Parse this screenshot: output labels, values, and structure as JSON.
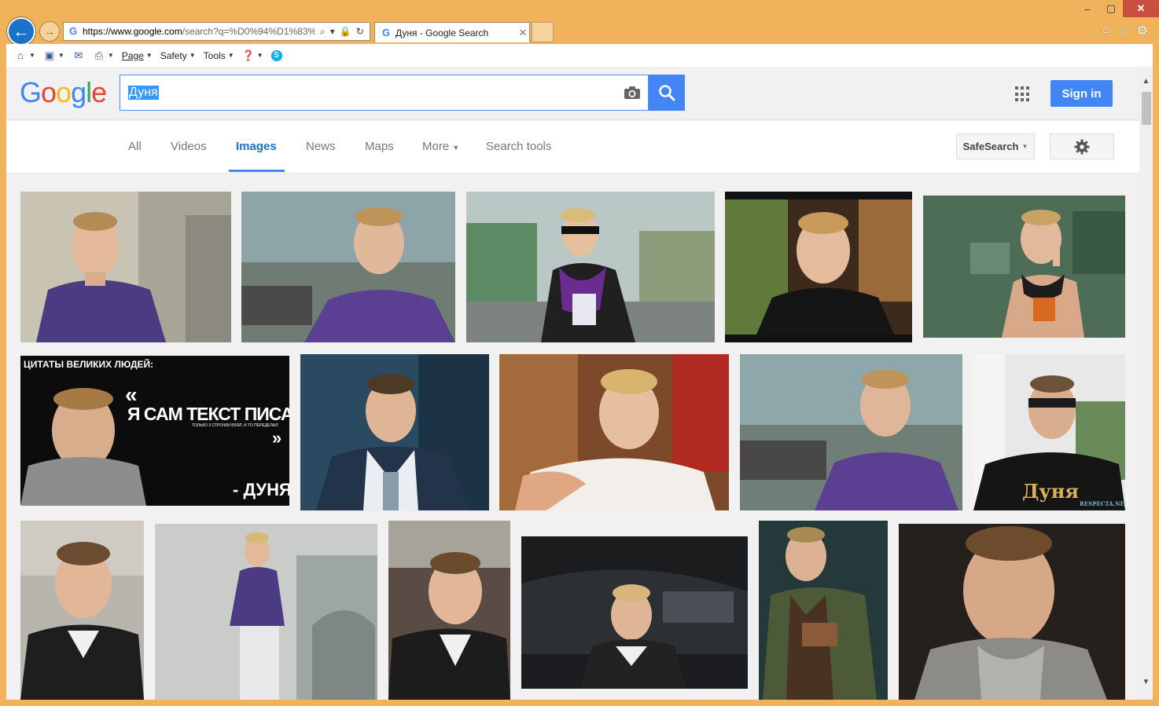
{
  "browser": {
    "url_domain": "https://www.google.com",
    "url_rest": "/search?q=%D0%94%D1%83%",
    "tab_title": "Дуня - Google Search",
    "cmd_items": [
      {
        "label": "Page"
      },
      {
        "label": "Safety"
      },
      {
        "label": "Tools"
      }
    ],
    "window_controls": {
      "minimize": "–",
      "maximize": "▢",
      "close": "✕"
    }
  },
  "google": {
    "query": "Дуня",
    "signin_label": "Sign in",
    "nav_tabs": [
      {
        "label": "All"
      },
      {
        "label": "Videos"
      },
      {
        "label": "Images",
        "active": true
      },
      {
        "label": "News"
      },
      {
        "label": "Maps"
      },
      {
        "label": "More"
      },
      {
        "label": "Search tools"
      }
    ],
    "safesearch_label": "SafeSearch",
    "colors": {
      "accent": "#4285f4",
      "chrome": "#f0b25b",
      "active_tab": "#1a73c9"
    }
  },
  "results": {
    "quote_card": {
      "heading": "ЦИТАТЫ ВЕЛИКИХ ЛЮДЕЙ:",
      "quote": "Я САМ ТЕКСТ ПИСАЛ",
      "subquote": "ТОЛЬКО 3 СТРОЧКИ ВЗЯЛ, И ТО ПЕРЕДЕЛАЛ",
      "author": "- ДУНЯ"
    },
    "shirt_watermark": "Дуня",
    "site_watermark": "RESPECTA.NET"
  }
}
